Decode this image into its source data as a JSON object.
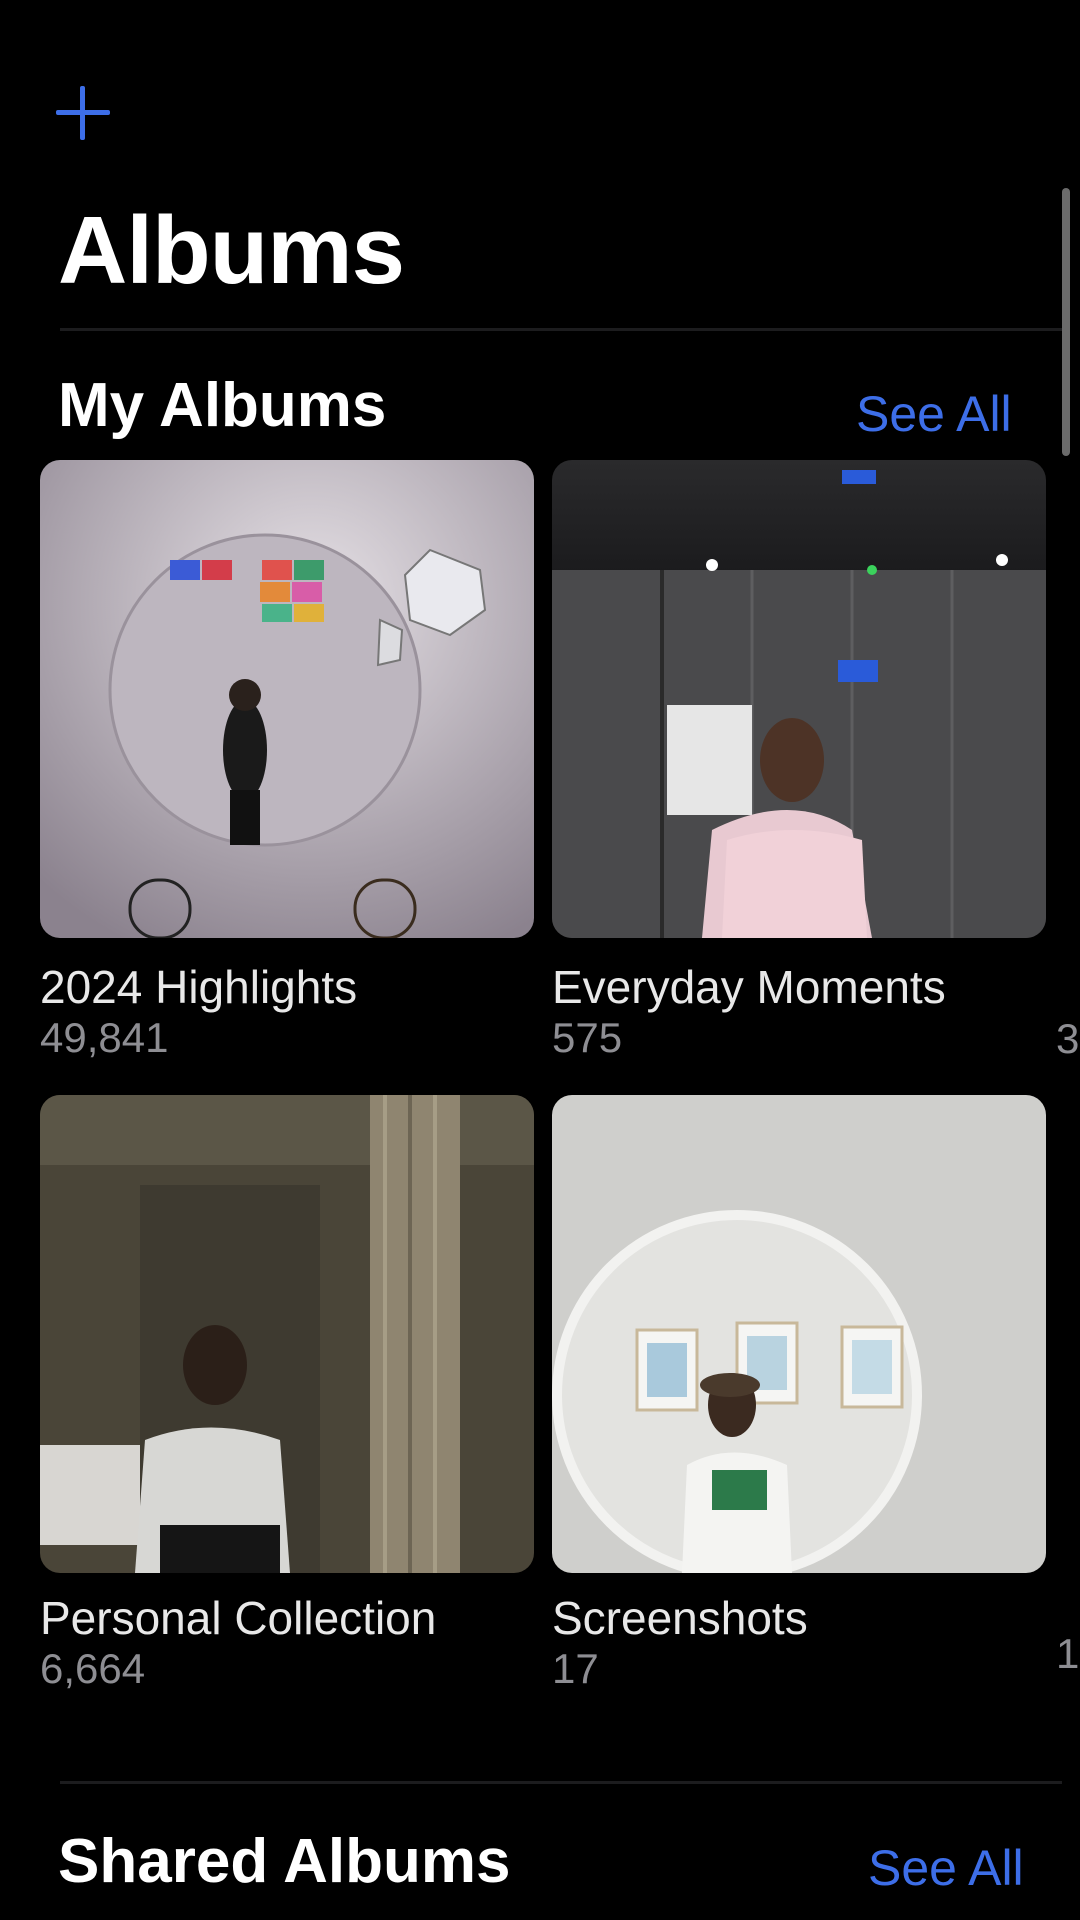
{
  "header": {
    "add_icon": "plus-icon",
    "title": "Albums"
  },
  "my_albums": {
    "title": "My Albums",
    "see_all": "See All",
    "albums": [
      {
        "name": "2024 Highlights",
        "count": "49,841"
      },
      {
        "name": "Everyday Moments",
        "count": "575"
      },
      {
        "name": "Personal Collection",
        "count": "6,664"
      },
      {
        "name": "Screenshots",
        "count": "17"
      }
    ],
    "peek_counts": [
      "3",
      "1"
    ]
  },
  "shared_albums": {
    "title": "Shared Albums",
    "see_all": "See All"
  },
  "colors": {
    "accent": "#3d6ee8",
    "background": "#000000",
    "secondary_text": "#8e8e93"
  }
}
